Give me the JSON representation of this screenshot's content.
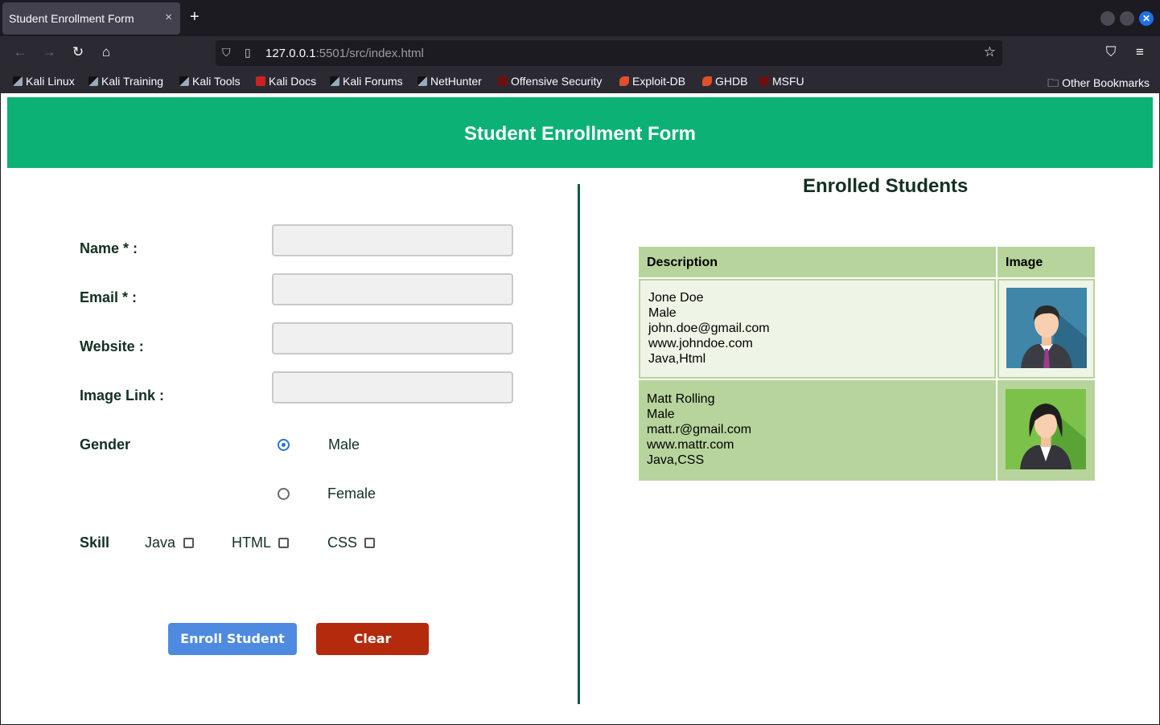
{
  "browser": {
    "tab_title": "Student Enrollment Form",
    "tab_close": "×",
    "new_tab": "+",
    "url_host": "127.0.0.1",
    "url_rest": ":5501/src/index.html",
    "bookmarks": [
      "Kali Linux",
      "Kali Training",
      "Kali Tools",
      "Kali Docs",
      "Kali Forums",
      "NetHunter",
      "Offensive Security",
      "Exploit-DB",
      "GHDB",
      "MSFU"
    ],
    "other_bookmarks": "Other Bookmarks"
  },
  "header": {
    "title": "Student Enrollment Form"
  },
  "form": {
    "name_label": "Name * :",
    "email_label": "Email * :",
    "website_label": "Website :",
    "image_label": "Image Link :",
    "name_value": "",
    "email_value": "",
    "website_value": "",
    "image_value": "",
    "gender_label": "Gender",
    "gender_options": [
      "Male",
      "Female"
    ],
    "gender_selected": "Male",
    "skill_label": "Skill",
    "skills": [
      "Java",
      "HTML",
      "CSS"
    ],
    "enroll_button": "Enroll Student",
    "clear_button": "Clear"
  },
  "enrolled": {
    "title": "Enrolled Students",
    "columns": [
      "Description",
      "Image"
    ],
    "students": [
      {
        "name": "Jone Doe",
        "gender": "Male",
        "email": "john.doe@gmail.com",
        "website": "www.johndoe.com",
        "skills": "Java,Html"
      },
      {
        "name": "Matt Rolling",
        "gender": "Male",
        "email": "matt.r@gmail.com",
        "website": "www.mattr.com",
        "skills": "Java,CSS"
      }
    ]
  },
  "colors": {
    "header_bg": "#0bb175",
    "table_header_bg": "#b8d49d",
    "enroll_button": "#4e8ae0",
    "clear_button": "#b32b0c",
    "divider": "#0c5e3e"
  }
}
